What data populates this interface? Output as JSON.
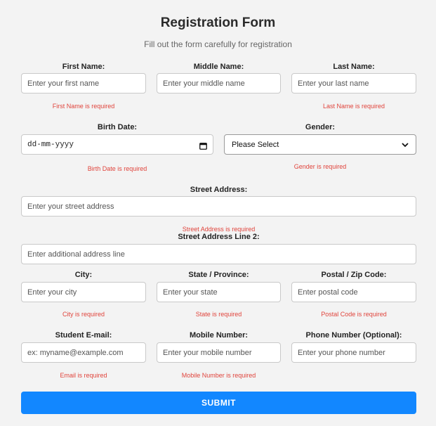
{
  "form": {
    "title": "Registration Form",
    "subtitle": "Fill out the form carefully for registration",
    "submit_label": "SUBMIT"
  },
  "fields": {
    "first_name": {
      "label": "First Name:",
      "placeholder": "Enter your first name",
      "error": "First Name is required"
    },
    "middle_name": {
      "label": "Middle Name:",
      "placeholder": "Enter your middle name"
    },
    "last_name": {
      "label": "Last Name:",
      "placeholder": "Enter your last name",
      "error": "Last Name is required"
    },
    "birth_date": {
      "label": "Birth Date:",
      "value": "dd-mm-yyyy",
      "error": "Birth Date is required"
    },
    "gender": {
      "label": "Gender:",
      "selected": "Please Select",
      "error": "Gender is required"
    },
    "street": {
      "label": "Street Address:",
      "placeholder": "Enter your street address",
      "error": "Street Address is required"
    },
    "street2": {
      "label": "Street Address Line 2:",
      "placeholder": "Enter additional address line"
    },
    "city": {
      "label": "City:",
      "placeholder": "Enter your city",
      "error": "City is required"
    },
    "state": {
      "label": "State / Province:",
      "placeholder": "Enter your state",
      "error": "State is required"
    },
    "postal": {
      "label": "Postal / Zip Code:",
      "placeholder": "Enter postal code",
      "error": "Postal Code is required"
    },
    "email": {
      "label": "Student E-mail:",
      "placeholder": "ex: myname@example.com",
      "error": "Email is required"
    },
    "mobile": {
      "label": "Mobile Number:",
      "placeholder": "Enter your mobile number",
      "error": "Mobile Number is required"
    },
    "phone": {
      "label": "Phone Number (Optional):",
      "placeholder": "Enter your phone number"
    }
  },
  "icons": {
    "birth_date": "calendar-icon",
    "gender": "chevron-down-icon"
  },
  "colors": {
    "accent": "#1287ff",
    "error": "#e0443c",
    "background": "#f3f3f3"
  }
}
